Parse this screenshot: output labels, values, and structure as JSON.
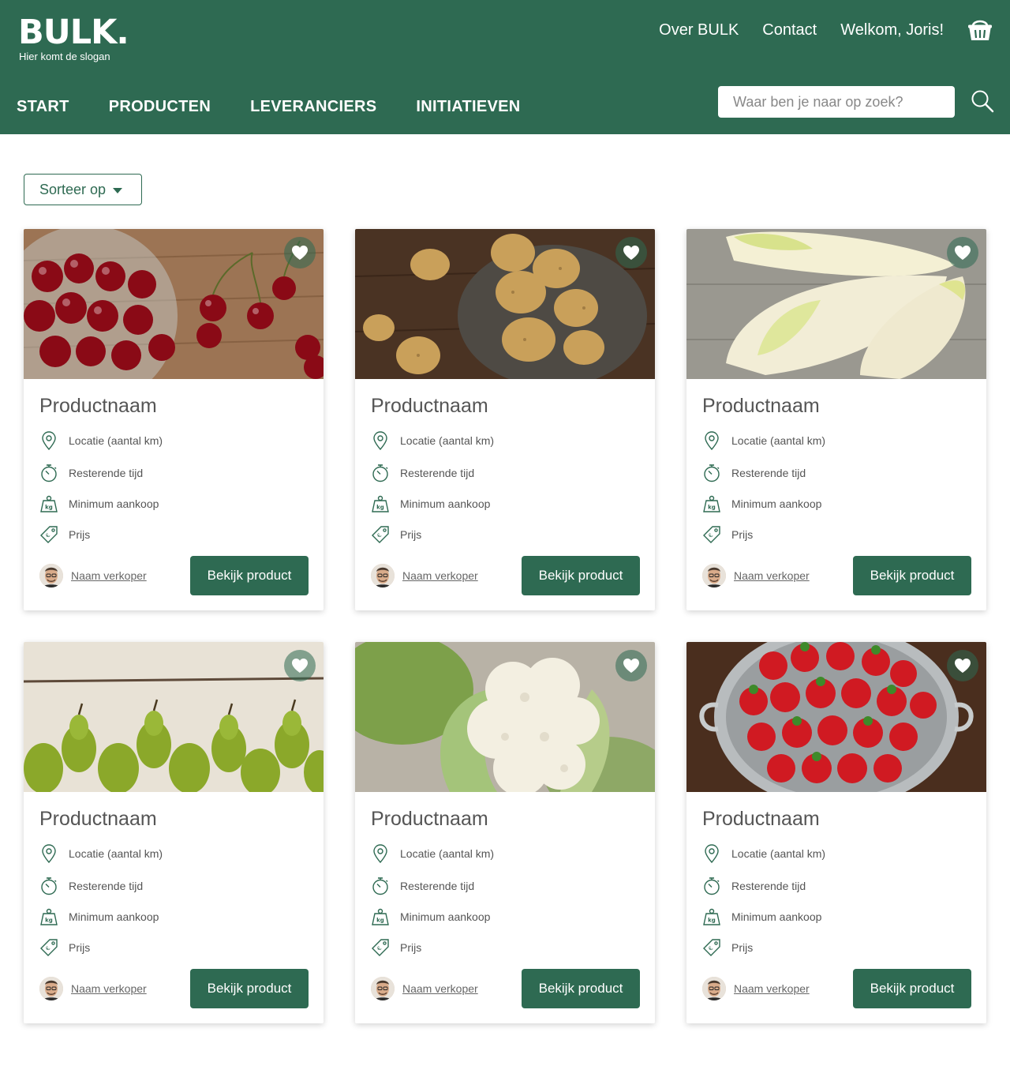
{
  "header": {
    "logo": "BULK.",
    "slogan": "Hier komt de slogan",
    "links": [
      "Over BULK",
      "Contact",
      "Welkom, Joris!"
    ],
    "cart_icon": "basket-icon"
  },
  "nav": {
    "items": [
      "START",
      "PRODUCTEN",
      "LEVERANCIERS",
      "INITIATIEVEN"
    ],
    "search_placeholder": "Waar ben je naar op zoek?",
    "search_icon": "search-icon"
  },
  "sort": {
    "label": "Sorteer op"
  },
  "colors": {
    "brand": "#2e6a52",
    "text": "#555555",
    "white": "#ffffff"
  },
  "products": [
    {
      "image": "cherries",
      "title": "Productnaam",
      "location": "Locatie (aantal km)",
      "time": "Resterende tijd",
      "minimum": "Minimum aankoop",
      "price": "Prijs",
      "seller": "Naam verkoper",
      "cta": "Bekijk product"
    },
    {
      "image": "potatoes",
      "title": "Productnaam",
      "location": "Locatie (aantal km)",
      "time": "Resterende tijd",
      "minimum": "Minimum aankoop",
      "price": "Prijs",
      "seller": "Naam verkoper",
      "cta": "Bekijk product"
    },
    {
      "image": "chicory",
      "title": "Productnaam",
      "location": "Locatie (aantal km)",
      "time": "Resterende tijd",
      "minimum": "Minimum aankoop",
      "price": "Prijs",
      "seller": "Naam verkoper",
      "cta": "Bekijk product"
    },
    {
      "image": "pears",
      "title": "Productnaam",
      "location": "Locatie (aantal km)",
      "time": "Resterende tijd",
      "minimum": "Minimum aankoop",
      "price": "Prijs",
      "seller": "Naam verkoper",
      "cta": "Bekijk product"
    },
    {
      "image": "cauliflower",
      "title": "Productnaam",
      "location": "Locatie (aantal km)",
      "time": "Resterende tijd",
      "minimum": "Minimum aankoop",
      "price": "Prijs",
      "seller": "Naam verkoper",
      "cta": "Bekijk product"
    },
    {
      "image": "strawberries",
      "title": "Productnaam",
      "location": "Locatie (aantal km)",
      "time": "Resterende tijd",
      "minimum": "Minimum aankoop",
      "price": "Prijs",
      "seller": "Naam verkoper",
      "cta": "Bekijk product"
    }
  ]
}
